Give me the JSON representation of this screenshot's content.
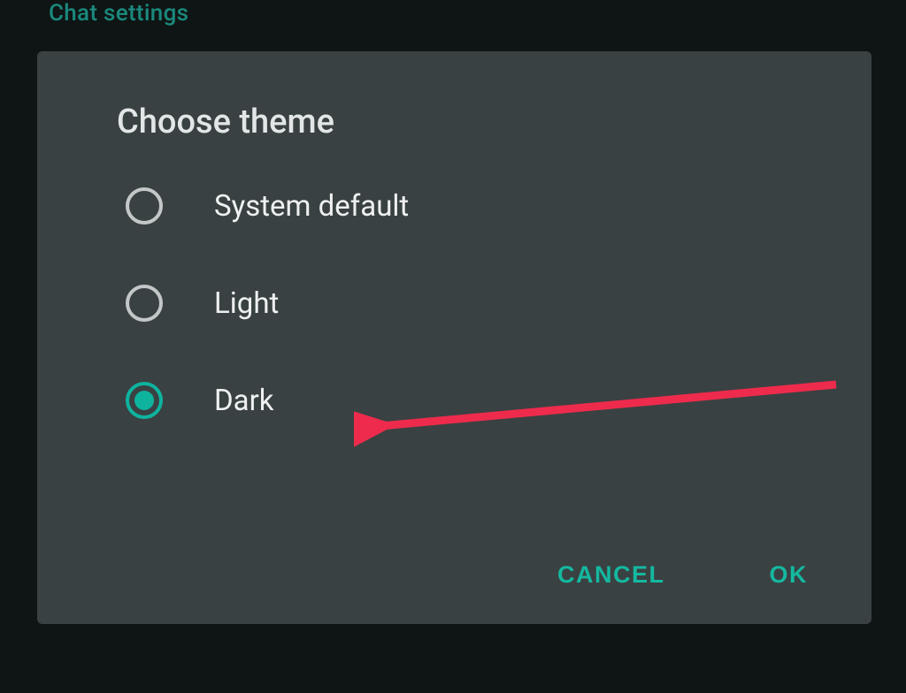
{
  "header": {
    "title": "Chat settings"
  },
  "dialog": {
    "title": "Choose theme",
    "options": [
      {
        "label": "System default",
        "selected": false
      },
      {
        "label": "Light",
        "selected": false
      },
      {
        "label": "Dark",
        "selected": true
      }
    ],
    "actions": {
      "cancel": "CANCEL",
      "ok": "OK"
    }
  }
}
